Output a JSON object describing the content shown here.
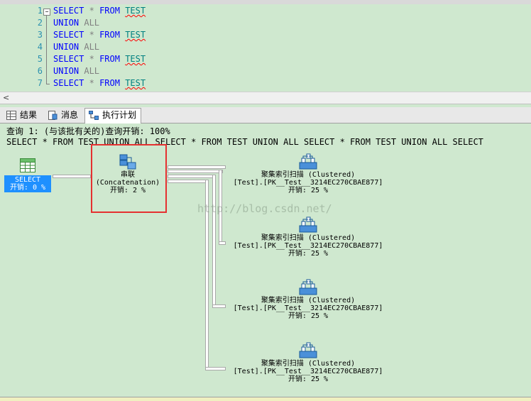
{
  "editor": {
    "lines": [
      {
        "num": "1",
        "kw1": "SELECT",
        "op": "*",
        "kw2": "FROM",
        "table": "TEST"
      },
      {
        "num": "2",
        "kw1": "UNION",
        "op": "",
        "kw2": "ALL",
        "table": ""
      },
      {
        "num": "3",
        "kw1": "SELECT",
        "op": "*",
        "kw2": "FROM",
        "table": "TEST"
      },
      {
        "num": "4",
        "kw1": "UNION",
        "op": "",
        "kw2": "ALL",
        "table": ""
      },
      {
        "num": "5",
        "kw1": "SELECT",
        "op": "*",
        "kw2": "FROM",
        "table": "TEST"
      },
      {
        "num": "6",
        "kw1": "UNION",
        "op": "",
        "kw2": "ALL",
        "table": ""
      },
      {
        "num": "7",
        "kw1": "SELECT",
        "op": "*",
        "kw2": "FROM",
        "table": "TEST"
      }
    ]
  },
  "tabs": [
    {
      "label": "结果",
      "icon": "grid-icon"
    },
    {
      "label": "消息",
      "icon": "message-icon"
    },
    {
      "label": "执行计划",
      "icon": "execution-plan-icon",
      "active": true
    }
  ],
  "plan": {
    "query_header": "查询 1: (与该批有关的)查询开销: 100%",
    "query_text": "SELECT * FROM TEST UNION ALL SELECT * FROM TEST UNION ALL SELECT * FROM TEST UNION ALL SELECT",
    "select_node": {
      "label": "SELECT",
      "cost": "开销: 0 %"
    },
    "concat_node": {
      "title": "串联",
      "subtitle": "(Concatenation)",
      "cost": "开销: 2 %"
    },
    "scan_nodes": [
      {
        "title": "聚集索引扫描 (Clustered)",
        "object": "[Test].[PK__Test__3214EC270CBAE877]",
        "cost": "开销: 25 %"
      },
      {
        "title": "聚集索引扫描 (Clustered)",
        "object": "[Test].[PK__Test__3214EC270CBAE877]",
        "cost": "开销: 25 %"
      },
      {
        "title": "聚集索引扫描 (Clustered)",
        "object": "[Test].[PK__Test__3214EC270CBAE877]",
        "cost": "开销: 25 %"
      },
      {
        "title": "聚集索引扫描 (Clustered)",
        "object": "[Test].[PK__Test__3214EC270CBAE877]",
        "cost": "开销: 25 %"
      }
    ],
    "watermark": "http://blog.csdn.net/",
    "highlight_color": "#e53030",
    "selected_color": "#1e90ff"
  }
}
